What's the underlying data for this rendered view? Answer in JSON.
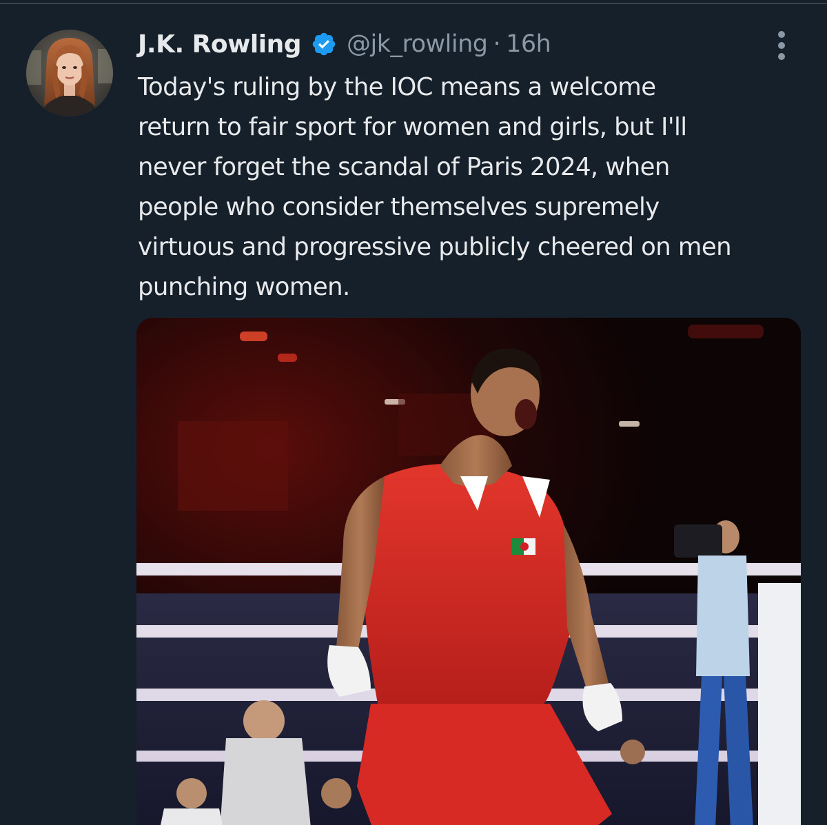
{
  "tweet": {
    "author": {
      "display_name": "J.K. Rowling",
      "handle": "@jk_rowling",
      "verified": true
    },
    "separator": "·",
    "timestamp": "16h",
    "text_lines": [
      "Today's ruling by the IOC means a welcome",
      "return to fair sport for women and girls, but I'll",
      "never forget the scandal of Paris 2024, when",
      "people who consider themselves supremely",
      "virtuous and progressive publicly cheered on men",
      "punching women."
    ],
    "media": {
      "type": "photo"
    }
  },
  "icons": {
    "verified": "verified-badge-icon",
    "more": "more-vertical-icon"
  },
  "colors": {
    "background": "#15202b",
    "primary_text": "#e7e9ea",
    "secondary_text": "#8b98a5",
    "verified_blue": "#1d9bf0",
    "divider": "#38444d"
  }
}
